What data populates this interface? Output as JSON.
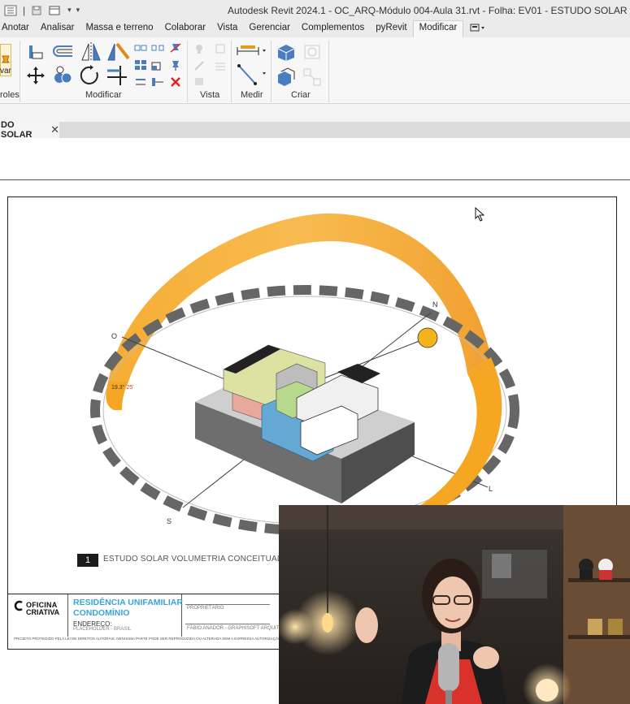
{
  "window": {
    "title": "Autodesk Revit 2024.1 - OC_ARQ-Módulo 004-Aula 31.rvt - Folha: EV01 - ESTUDO SOLAR"
  },
  "menu": {
    "tabs": [
      "Anotar",
      "Analisar",
      "Massa e terreno",
      "Colaborar",
      "Vista",
      "Gerenciar",
      "Complementos",
      "pyRevit",
      "Modificar"
    ],
    "active_tab": "Modificar"
  },
  "ribbon": {
    "partial_button_label": "var",
    "partial_panel_label": "roles",
    "panels": {
      "modificar": "Modificar",
      "vista": "Vista",
      "medir": "Medir",
      "criar": "Criar"
    }
  },
  "view_tab": {
    "label": "DO SOLAR",
    "close": "✕"
  },
  "sheet": {
    "compass": {
      "north": "N",
      "south": "S",
      "east": "L",
      "west": "O"
    },
    "angle_label": "19.3°",
    "angle_suffix": "25'",
    "view_number": "1",
    "view_title": "ESTUDO SOLAR VOLUMETRIA CONCEITUAL",
    "title_block": {
      "logo_line1": "OFICINA",
      "logo_line2": "CRIATIVA",
      "project_line1": "RESIDÊNCIA UNIFAMILIAR",
      "project_line2": "CONDOMÍNIO",
      "endereco_label": "ENDEREÇO:",
      "endereco_value": "PLACEHOLDER - BRASIL",
      "proprietario_label": "PROPRIETÁRIO",
      "responsavel": "FÁBIO ANÁDOR - GRAPHISOFT ARQUITETURA",
      "footnote": "PROJETO PROTEGIDO PELA LEI DE DIREITOS AUTORAIS. NENHUMA PARTE PODE SER REPRODUZIDA OU ALTERADA SEM A EXPRESSA AUTORIZAÇÃO DO AUTOR."
    }
  },
  "colors": {
    "sun_path": "#f5a623",
    "sun_path_dark": "#e8901a",
    "ring_dark": "#5a5a5a",
    "accent_blue": "#3aa4d8",
    "building_base": "#6e6e6e"
  },
  "icons": [
    "menu-icon",
    "save-icon",
    "sync-icon",
    "dropdown-icon",
    "align-icon",
    "offset-icon",
    "mirror-icon",
    "move-icon",
    "copy-icon",
    "rotate-icon",
    "trim-icon",
    "scale-icon",
    "array-icon",
    "delete-icon",
    "measure-icon",
    "create-group-icon",
    "cursor-icon"
  ]
}
